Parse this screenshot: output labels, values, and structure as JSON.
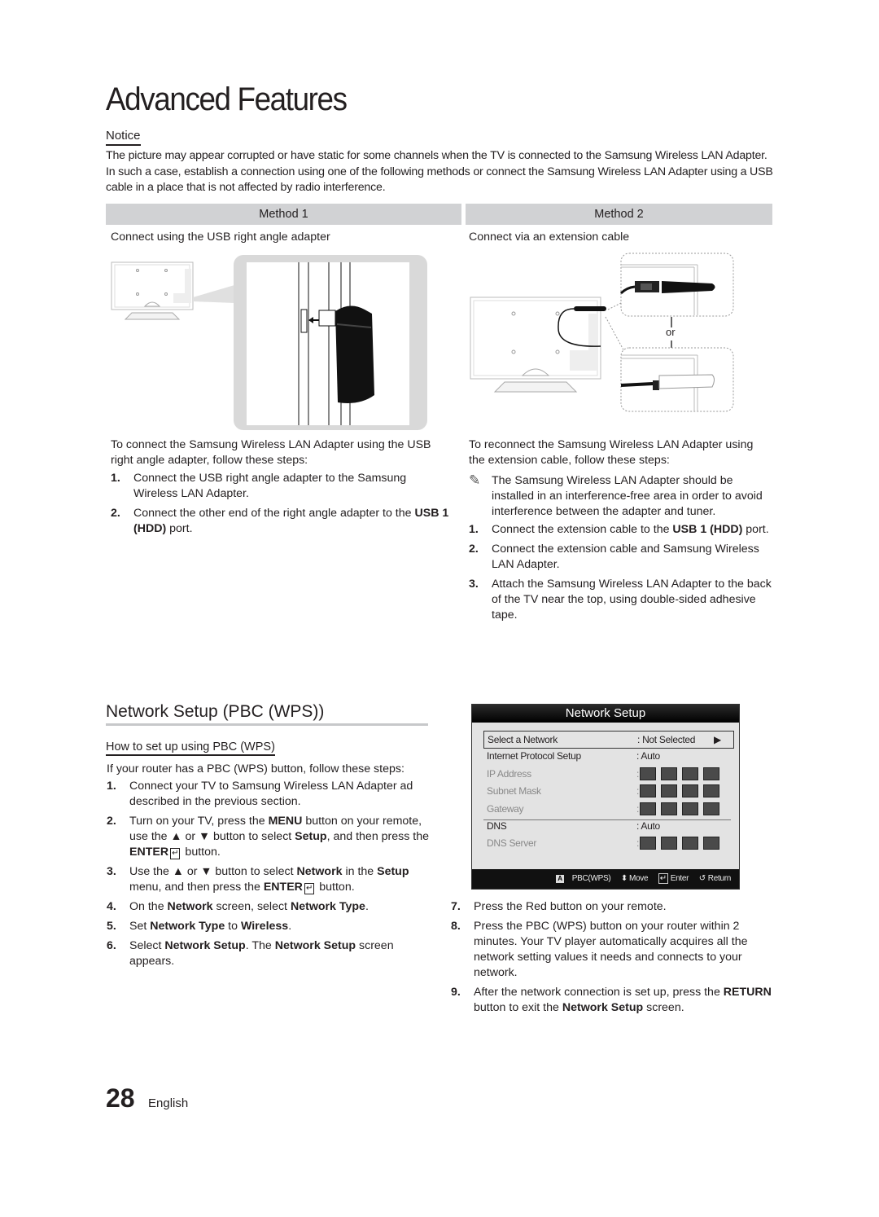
{
  "page": {
    "title": "Advanced Features",
    "number": "28",
    "language": "English"
  },
  "notice": {
    "heading": "Notice",
    "body": "The picture may appear corrupted or have static for some channels when the TV is connected to the Samsung Wireless LAN Adapter. In such a case, establish a connection using one of the following methods or connect the Samsung Wireless LAN Adapter using a USB cable in a place that is not affected by radio interference."
  },
  "method1": {
    "heading": "Method 1",
    "description": "Connect using the USB right angle adapter",
    "intro": "To connect the Samsung Wireless LAN Adapter using the USB right angle adapter, follow these steps:",
    "steps": [
      {
        "num": "1.",
        "text": "Connect the USB right angle adapter to the Samsung Wireless LAN Adapter."
      },
      {
        "num": "2.",
        "pre": "Connect the other end of the right angle adapter to the ",
        "bold": "USB 1 (HDD)",
        "post": " port."
      }
    ]
  },
  "method2": {
    "heading": "Method 2",
    "description": "Connect via an extension cable",
    "or_label": "or",
    "intro": "To reconnect the Samsung Wireless LAN Adapter using the extension cable, follow these steps:",
    "note": "The Samsung Wireless LAN Adapter should be installed in an interference-free area in order to avoid interference between the adapter and tuner.",
    "steps": [
      {
        "num": "1.",
        "pre": "Connect the extension cable to the ",
        "bold": "USB 1 (HDD)",
        "post": " port."
      },
      {
        "num": "2.",
        "text": "Connect the extension cable and Samsung Wireless LAN Adapter."
      },
      {
        "num": "3.",
        "text": "Attach the Samsung Wireless LAN Adapter to the back of the TV near the top, using double-sided adhesive tape."
      }
    ]
  },
  "pbc": {
    "heading": "Network Setup (PBC (WPS))",
    "subheading": "How to set up using PBC (WPS)",
    "intro": "If your router has a PBC (WPS) button, follow these steps:",
    "steps": {
      "s1": {
        "num": "1.",
        "text": "Connect your TV to Samsung Wireless LAN Adapter ad described in the previous section."
      },
      "s2": {
        "num": "2.",
        "a": "Turn on your TV, press the ",
        "b": "MENU",
        "c": " button on your remote, use the ▲ or ▼ button to select ",
        "d": "Setup",
        "e": ", and then press the ",
        "f": "ENTER",
        "g": " button."
      },
      "s3": {
        "num": "3.",
        "a": "Use the ▲ or ▼ button to select ",
        "b": "Network",
        "c": " in the ",
        "d": "Setup",
        "e": " menu, and then press the ",
        "f": "ENTER",
        "g": " button."
      },
      "s4": {
        "num": "4.",
        "a": "On the ",
        "b": "Network",
        "c": " screen, select ",
        "d": "Network Type",
        "e": "."
      },
      "s5": {
        "num": "5.",
        "a": "Set ",
        "b": "Network Type",
        "c": " to ",
        "d": "Wireless",
        "e": "."
      },
      "s6": {
        "num": "6.",
        "a": "Select ",
        "b": "Network Setup",
        "c": ". The ",
        "d": "Network Setup",
        "e": " screen appears."
      },
      "s7": {
        "num": "7.",
        "text": "Press the Red button on your remote."
      },
      "s8": {
        "num": "8.",
        "text": "Press the PBC (WPS) button on your router within 2 minutes. Your TV player automatically acquires all the network setting values it needs and connects to your network."
      },
      "s9": {
        "num": "9.",
        "a": "After the network connection is set up, press the ",
        "b": "RETURN",
        "c": " button to exit the ",
        "d": "Network Setup",
        "e": " screen."
      }
    }
  },
  "tv_menu": {
    "title": "Network Setup",
    "rows": [
      {
        "label": "Select a Network",
        "value": ": Not Selected",
        "arrow": "▶"
      },
      {
        "label": "Internet Protocol Setup",
        "value": ": Auto"
      },
      {
        "label": "IP Address",
        "value": ":"
      },
      {
        "label": "Subnet Mask",
        "value": ":"
      },
      {
        "label": "Gateway",
        "value": ":"
      },
      {
        "label": "DNS",
        "value": ": Auto"
      },
      {
        "label": "DNS Server",
        "value": ":"
      }
    ],
    "footer": {
      "a_key": "A",
      "pbc": "PBC(WPS)",
      "move": "Move",
      "enter": "Enter",
      "return": "Return"
    }
  }
}
